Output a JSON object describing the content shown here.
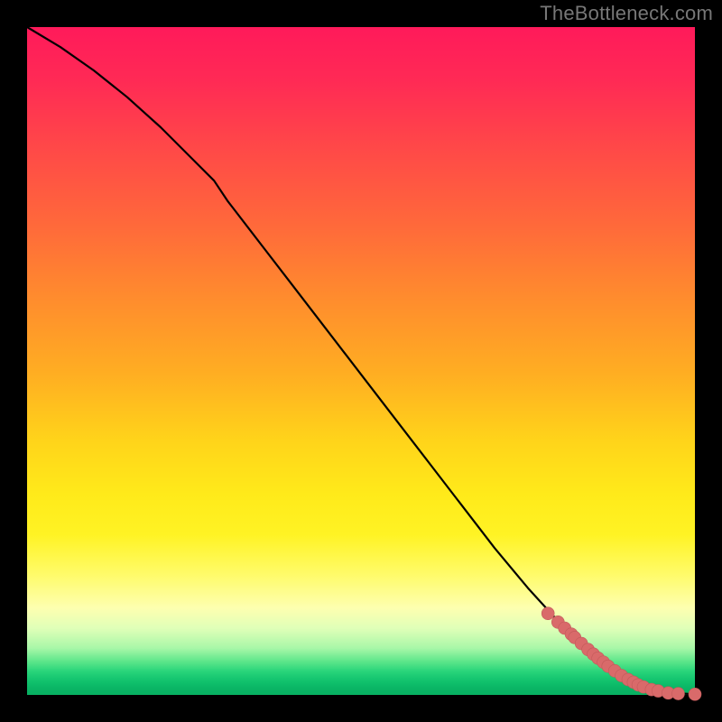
{
  "watermark": "TheBottleneck.com",
  "chart_data": {
    "type": "line",
    "title": "",
    "xlabel": "",
    "ylabel": "",
    "xlim": [
      0,
      100
    ],
    "ylim": [
      0,
      100
    ],
    "grid": false,
    "legend": false,
    "background_gradient": {
      "direction": "top-to-bottom",
      "stops": [
        {
          "pos": 0,
          "color": "#ff1a5a"
        },
        {
          "pos": 30,
          "color": "#ff6a3a"
        },
        {
          "pos": 62,
          "color": "#ffd41a"
        },
        {
          "pos": 82,
          "color": "#fdffb0"
        },
        {
          "pos": 96,
          "color": "#28d47a"
        },
        {
          "pos": 100,
          "color": "#07b061"
        }
      ]
    },
    "series": [
      {
        "name": "curve",
        "type": "line",
        "color": "#000000",
        "x": [
          0,
          5,
          10,
          15,
          20,
          25,
          28,
          30,
          35,
          40,
          45,
          50,
          55,
          60,
          65,
          70,
          75,
          80,
          85,
          88,
          90,
          92,
          94,
          96,
          98,
          100
        ],
        "y": [
          100,
          97,
          93.5,
          89.5,
          85,
          80,
          77,
          74,
          67.5,
          61,
          54.5,
          48,
          41.5,
          35,
          28.5,
          22,
          16,
          10.5,
          5.5,
          3.2,
          2.0,
          1.2,
          0.7,
          0.4,
          0.2,
          0.1
        ]
      },
      {
        "name": "points",
        "type": "scatter",
        "color": "#d96a6a",
        "x": [
          78,
          79.5,
          80.5,
          81.5,
          82,
          83,
          84,
          84.8,
          85.5,
          86.3,
          87,
          88,
          89,
          90,
          90.8,
          91.5,
          92.3,
          93.5,
          94.5,
          96,
          97.5,
          100
        ],
        "y": [
          12.2,
          10.9,
          10.0,
          9.1,
          8.6,
          7.7,
          6.8,
          6.1,
          5.5,
          4.9,
          4.3,
          3.6,
          2.9,
          2.3,
          1.9,
          1.5,
          1.2,
          0.8,
          0.6,
          0.3,
          0.2,
          0.1
        ]
      }
    ]
  }
}
